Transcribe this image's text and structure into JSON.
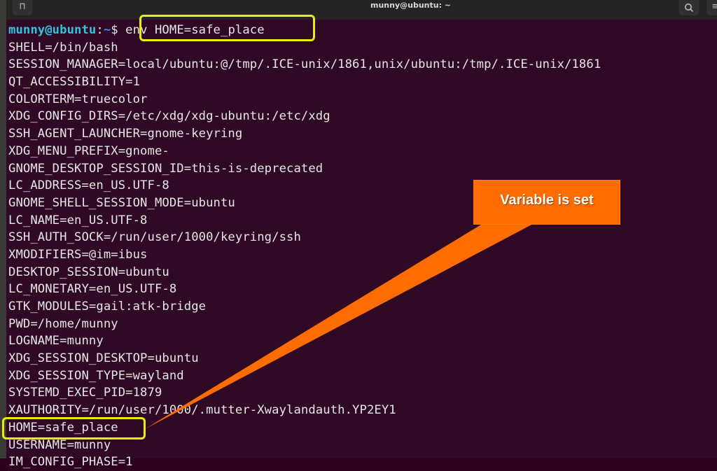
{
  "window": {
    "title": "munny@ubuntu: ~",
    "icons": {
      "new_tab": "new-tab-icon",
      "search": "search-icon",
      "menu": "hamburger-menu-icon"
    }
  },
  "prompt": {
    "user_host": "munny@ubuntu",
    "separator": ":",
    "path": "~",
    "symbol": "$",
    "command": " env HOME=safe_place"
  },
  "output_lines": [
    "SHELL=/bin/bash",
    "SESSION_MANAGER=local/ubuntu:@/tmp/.ICE-unix/1861,unix/ubuntu:/tmp/.ICE-unix/1861",
    "QT_ACCESSIBILITY=1",
    "COLORTERM=truecolor",
    "XDG_CONFIG_DIRS=/etc/xdg/xdg-ubuntu:/etc/xdg",
    "SSH_AGENT_LAUNCHER=gnome-keyring",
    "XDG_MENU_PREFIX=gnome-",
    "GNOME_DESKTOP_SESSION_ID=this-is-deprecated",
    "LC_ADDRESS=en_US.UTF-8",
    "GNOME_SHELL_SESSION_MODE=ubuntu",
    "LC_NAME=en_US.UTF-8",
    "SSH_AUTH_SOCK=/run/user/1000/keyring/ssh",
    "XMODIFIERS=@im=ibus",
    "DESKTOP_SESSION=ubuntu",
    "LC_MONETARY=en_US.UTF-8",
    "GTK_MODULES=gail:atk-bridge",
    "PWD=/home/munny",
    "LOGNAME=munny",
    "XDG_SESSION_DESKTOP=ubuntu",
    "XDG_SESSION_TYPE=wayland",
    "SYSTEMD_EXEC_PID=1879",
    "XAUTHORITY=/run/user/1000/.mutter-Xwaylandauth.YP2EY1",
    "HOME=safe_place",
    "USERNAME=munny",
    "IM_CONFIG_PHASE=1"
  ],
  "annotation": {
    "label": "Variable is set",
    "color": "#ff6d00",
    "highlight_color": "#e8f000"
  }
}
